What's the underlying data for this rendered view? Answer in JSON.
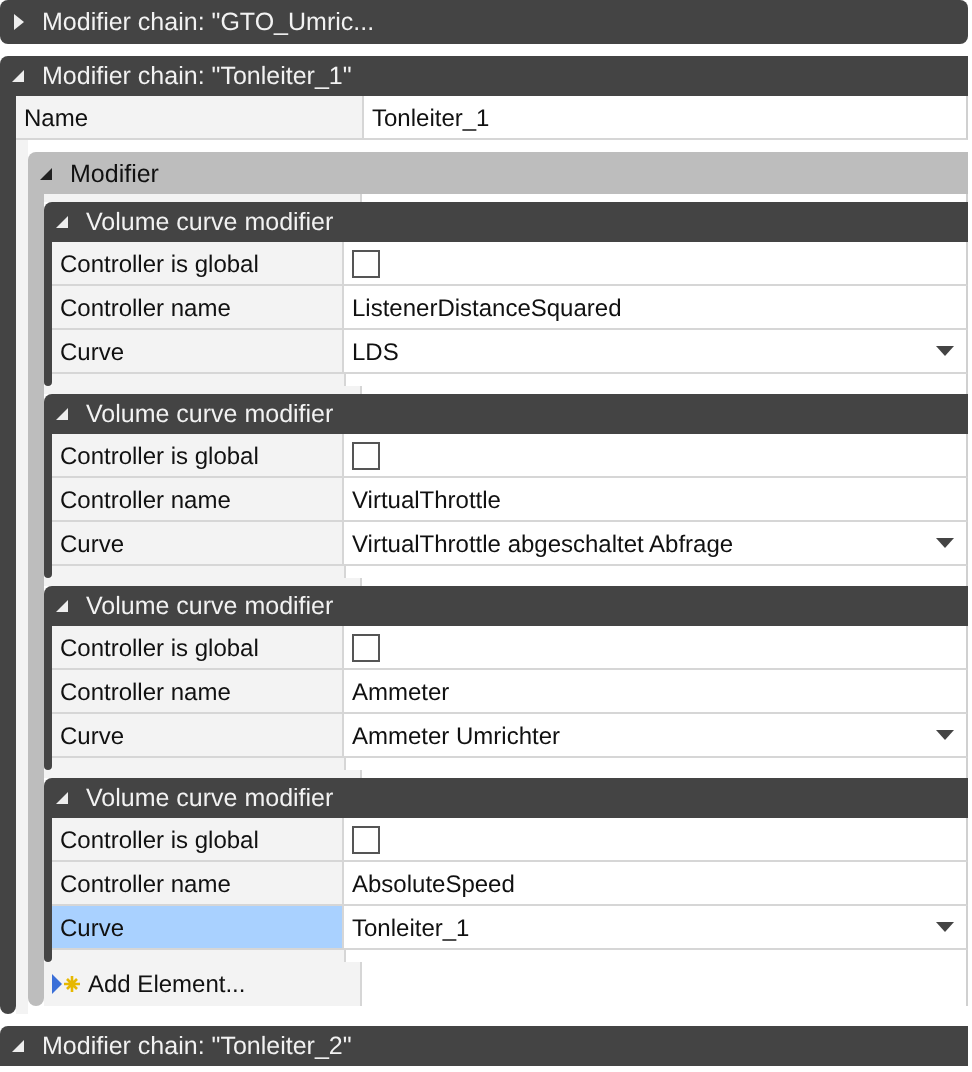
{
  "chains": [
    {
      "title": "Modifier chain: \"GTO_Umric...",
      "expanded": false
    },
    {
      "title": "Modifier chain: \"Tonleiter_1\"",
      "expanded": true,
      "properties": [
        {
          "label": "Name",
          "value": "Tonleiter_1"
        }
      ],
      "groups": [
        {
          "title": "Modifier",
          "expanded": true,
          "add_label": "Add Element...",
          "items": [
            {
              "title": "Volume curve modifier",
              "expanded": true,
              "properties": [
                {
                  "kind": "checkbox",
                  "label": "Controller is global",
                  "checked": false,
                  "selected": false
                },
                {
                  "kind": "text",
                  "label": "Controller name",
                  "value": "ListenerDistanceSquared",
                  "selected": false
                },
                {
                  "kind": "dropdown",
                  "label": "Curve",
                  "value": "LDS",
                  "selected": false
                }
              ]
            },
            {
              "title": "Volume curve modifier",
              "expanded": true,
              "properties": [
                {
                  "kind": "checkbox",
                  "label": "Controller is global",
                  "checked": false,
                  "selected": false
                },
                {
                  "kind": "text",
                  "label": "Controller name",
                  "value": "VirtualThrottle",
                  "selected": false
                },
                {
                  "kind": "dropdown",
                  "label": "Curve",
                  "value": "VirtualThrottle abgeschaltet Abfrage",
                  "selected": false
                }
              ]
            },
            {
              "title": "Volume curve modifier",
              "expanded": true,
              "properties": [
                {
                  "kind": "checkbox",
                  "label": "Controller is global",
                  "checked": false,
                  "selected": false
                },
                {
                  "kind": "text",
                  "label": "Controller name",
                  "value": "Ammeter",
                  "selected": false
                },
                {
                  "kind": "dropdown",
                  "label": "Curve",
                  "value": "Ammeter Umrichter",
                  "selected": false
                }
              ]
            },
            {
              "title": "Volume curve modifier",
              "expanded": true,
              "properties": [
                {
                  "kind": "checkbox",
                  "label": "Controller is global",
                  "checked": false,
                  "selected": false
                },
                {
                  "kind": "text",
                  "label": "Controller name",
                  "value": "AbsoluteSpeed",
                  "selected": false
                },
                {
                  "kind": "dropdown",
                  "label": "Curve",
                  "value": "Tonleiter_1",
                  "selected": true
                }
              ]
            }
          ]
        }
      ]
    },
    {
      "title": "Modifier chain: \"Tonleiter_2\"",
      "expanded": true
    }
  ]
}
